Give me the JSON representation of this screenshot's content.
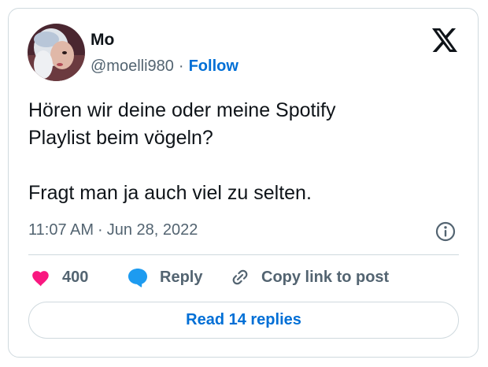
{
  "author": {
    "display_name": "Mo",
    "handle": "@moelli980",
    "separator": "·",
    "follow_label": "Follow"
  },
  "tweet": {
    "text": "Hören wir deine oder meine Spotify\nPlaylist beim vögeln?\n\nFragt man ja auch viel zu selten.",
    "time": "11:07 AM",
    "separator": "·",
    "date": "Jun 28, 2022"
  },
  "actions": {
    "like_count": "400",
    "reply_label": "Reply",
    "copy_link_label": "Copy link to post"
  },
  "replies": {
    "read_label": "Read 14 replies"
  },
  "icons": {
    "logo": "x-logo-icon",
    "info": "info-icon",
    "like": "heart-icon",
    "reply": "speech-bubble-icon",
    "copy_link": "link-icon"
  },
  "colors": {
    "accent": "#006fd6",
    "like": "#f91880",
    "reply": "#1d9bf0",
    "text_primary": "#0f1419",
    "text_secondary": "#536471",
    "border": "#cfd9de"
  }
}
